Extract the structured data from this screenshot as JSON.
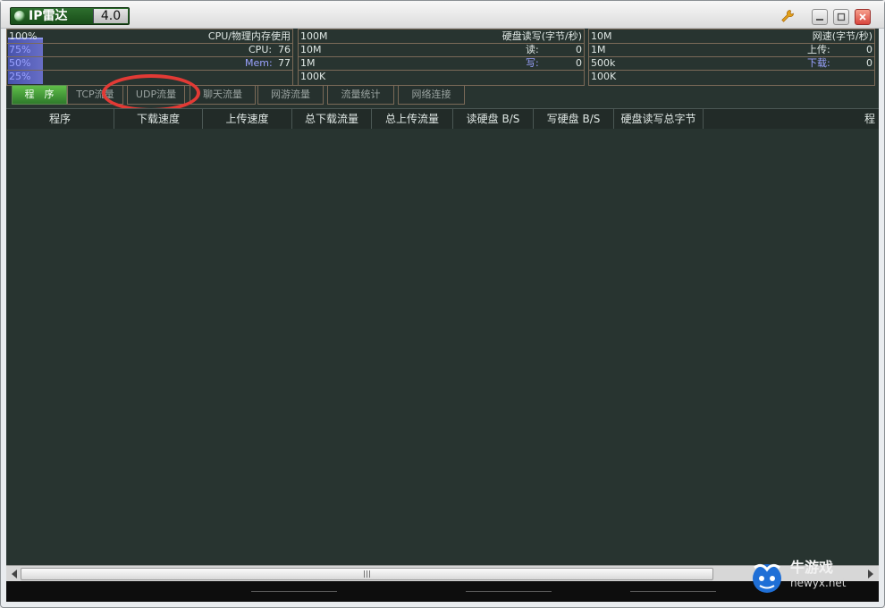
{
  "app": {
    "name": "IP雷达",
    "version": "4.0"
  },
  "panels": {
    "cpu": {
      "title": "CPU/物理内存使用",
      "scale": [
        "100%",
        "75%",
        "50%",
        "25%"
      ],
      "cpu_label": "CPU:",
      "cpu_value": "76",
      "mem_label": "Mem:",
      "mem_value": "77"
    },
    "disk": {
      "title": "硬盘读写(字节/秒)",
      "scale": [
        "100M",
        "10M",
        "1M",
        "100K"
      ],
      "read_label": "读:",
      "read_value": "0",
      "write_label": "写:",
      "write_value": "0"
    },
    "net": {
      "title": "网速(字节/秒)",
      "scale": [
        "10M",
        "1M",
        "500k",
        "100K"
      ],
      "up_label": "上传:",
      "up_value": "0",
      "down_label": "下载:",
      "down_value": "0"
    }
  },
  "tabs": [
    {
      "label": "程　序",
      "active": true
    },
    {
      "label": "TCP流量"
    },
    {
      "label": "UDP流量"
    },
    {
      "label": "聊天流量"
    },
    {
      "label": "网游流量"
    },
    {
      "label": "流量统计"
    },
    {
      "label": "网络连接"
    }
  ],
  "table": {
    "columns": [
      "程序",
      "下载速度",
      "上传速度",
      "总下载流量",
      "总上传流量",
      "读硬盘 B/S",
      "写硬盘 B/S",
      "硬盘读写总字节",
      "程"
    ]
  },
  "watermark": {
    "text": "牛游戏",
    "url": "newyx.net"
  },
  "colors": {
    "accent": "#4aa83a",
    "background": "#283430",
    "border": "#7b6a58",
    "highlight": "#e23a35"
  }
}
